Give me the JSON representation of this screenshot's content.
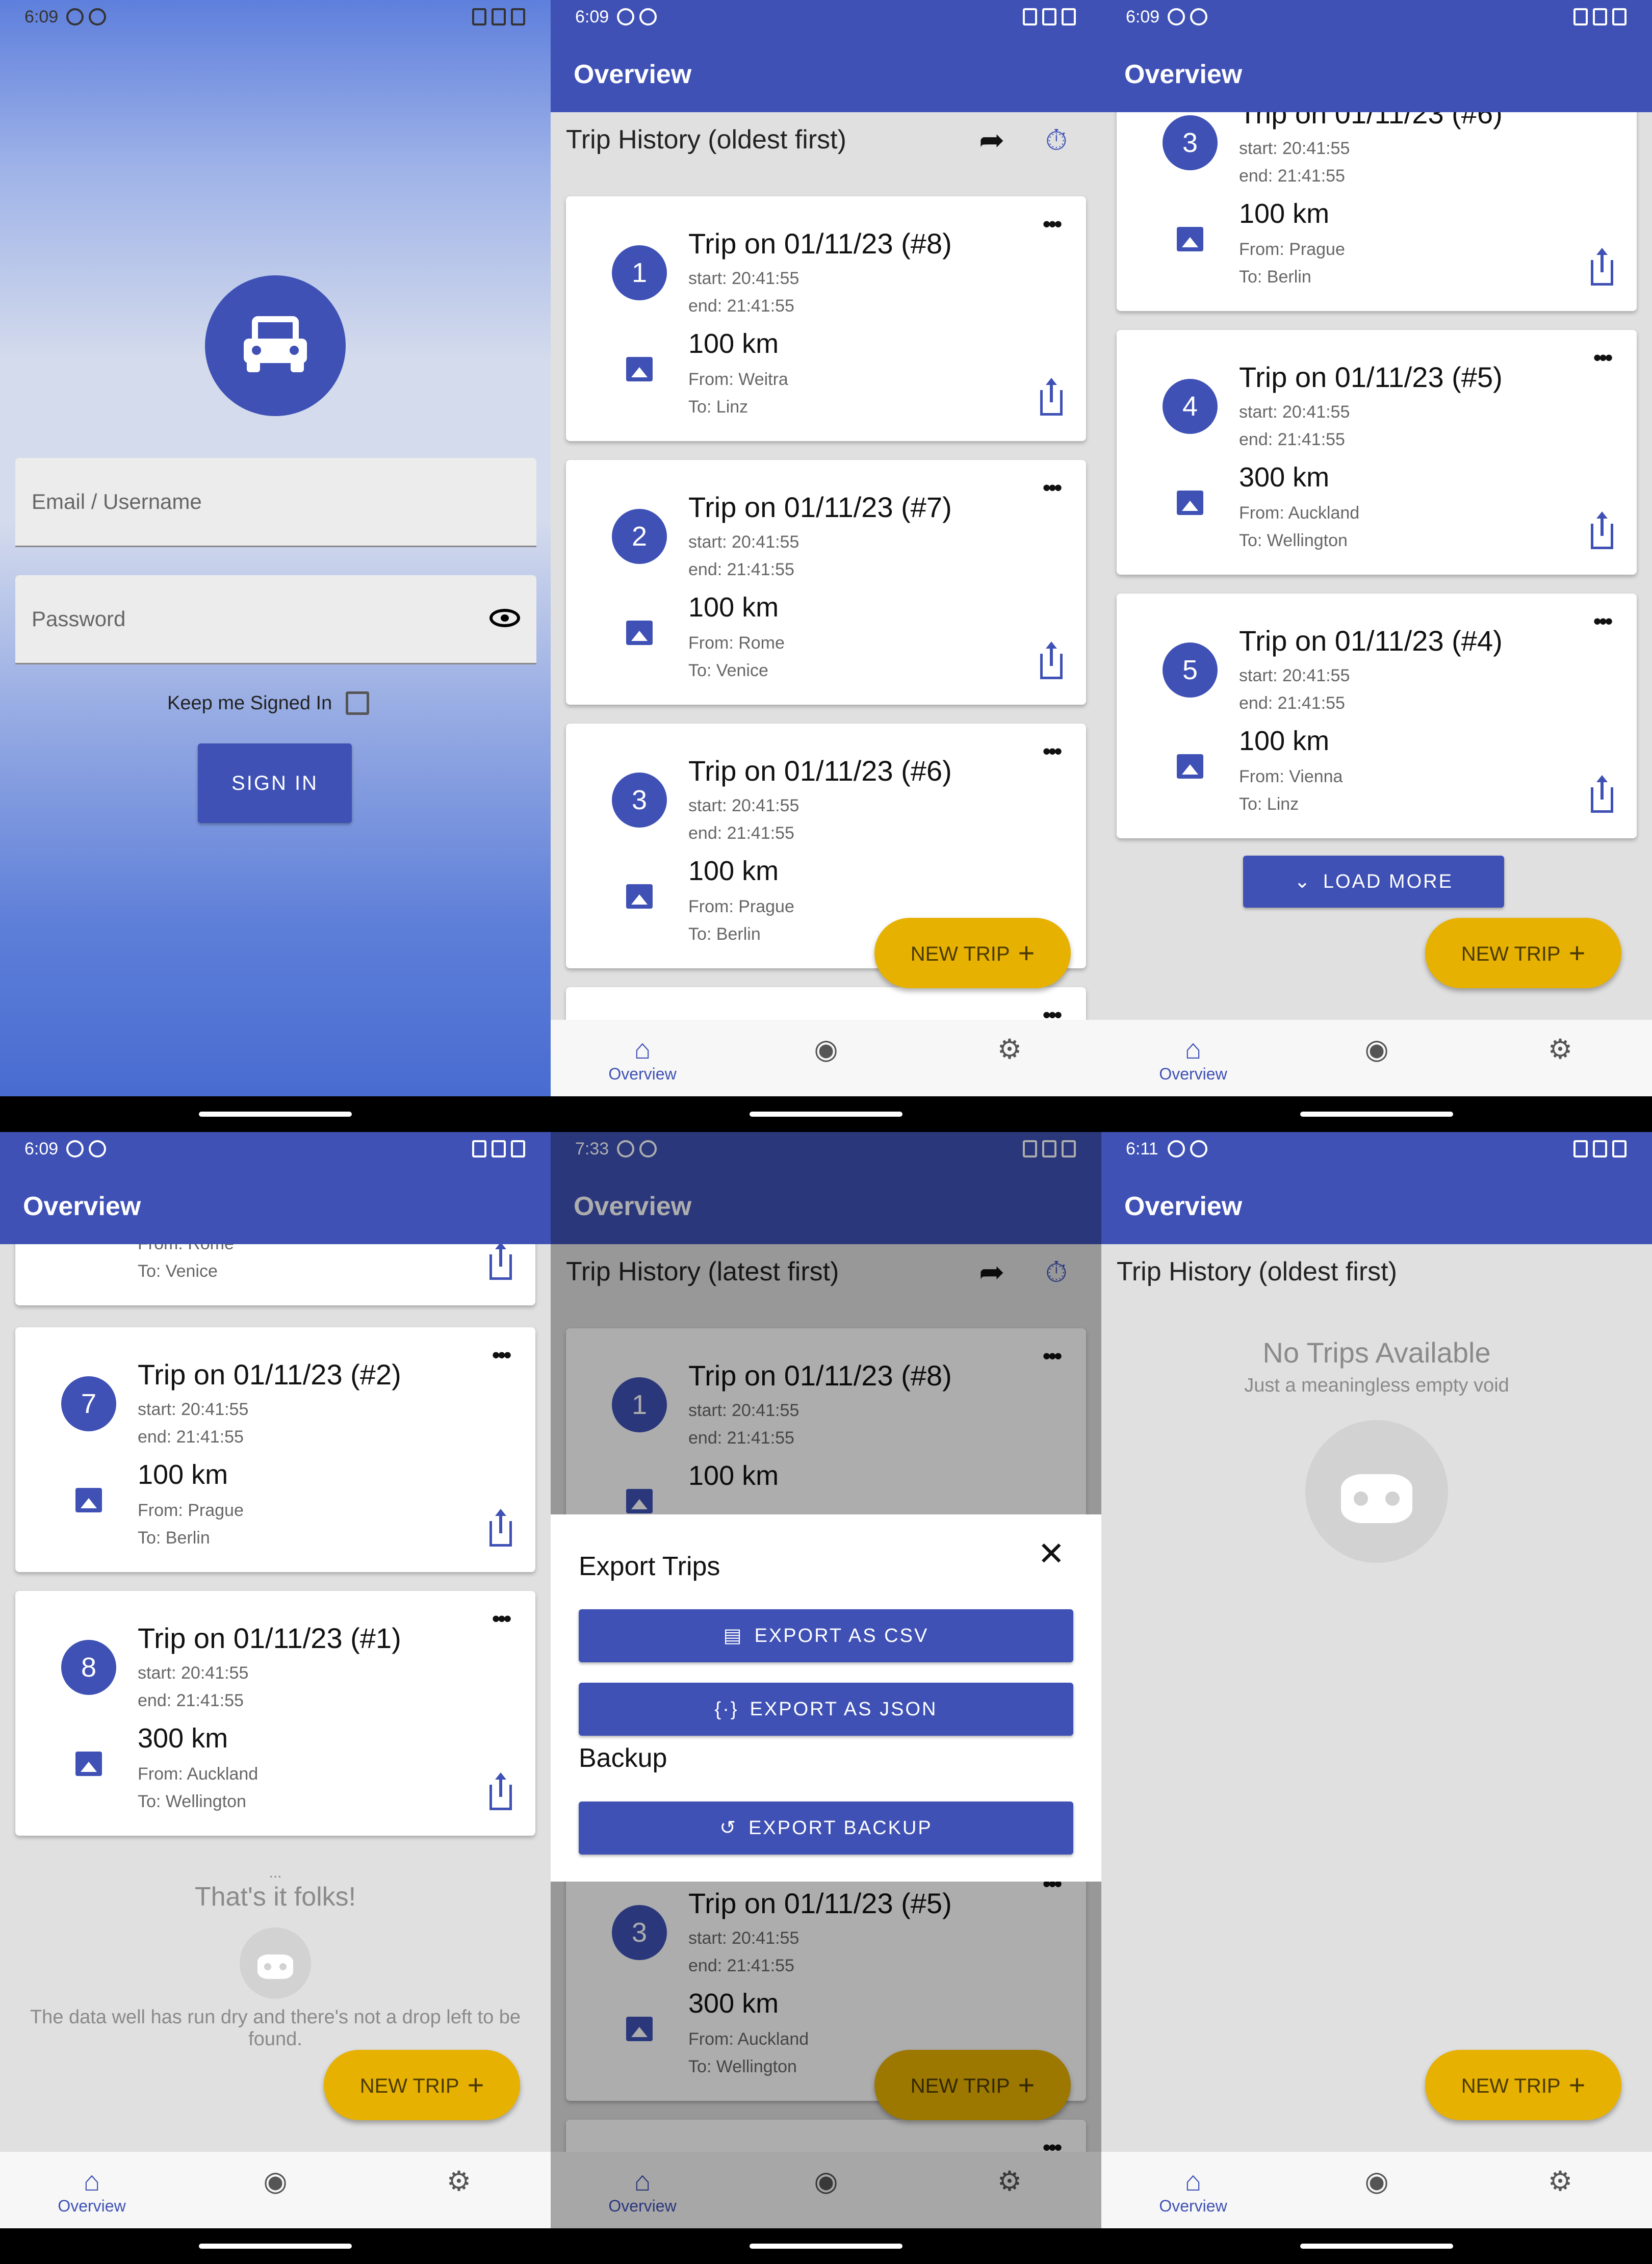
{
  "status": {
    "time1": "6:09",
    "time5": "7:33",
    "time6": "6:11"
  },
  "appbar_title": "Overview",
  "login": {
    "email_placeholder": "Email / Username",
    "password_placeholder": "Password",
    "keep_signed_in": "Keep me Signed In",
    "sign_in": "SIGN IN"
  },
  "history": {
    "title_oldest": "Trip History (oldest first)",
    "title_latest": "Trip History (latest first)"
  },
  "common": {
    "start": "start: 20:41:55",
    "end": "end: 21:41:55"
  },
  "trips": [
    {
      "num": "1",
      "title": "Trip on 01/11/23 (#8)",
      "km": "100 km",
      "from": "From: Weitra",
      "to": "To: Linz"
    },
    {
      "num": "2",
      "title": "Trip on 01/11/23 (#7)",
      "km": "100 km",
      "from": "From: Rome",
      "to": "To: Venice"
    },
    {
      "num": "3",
      "title": "Trip on 01/11/23 (#6)",
      "km": "100 km",
      "from": "From: Prague",
      "to": "To: Berlin"
    },
    {
      "num": "4",
      "title": "Trip on 01/11/23 (#5)",
      "km": "300 km",
      "from": "From: Auckland",
      "to": "To: Wellington"
    },
    {
      "num": "5",
      "title": "Trip on 01/11/23 (#4)",
      "km": "100 km",
      "from": "From: Vienna",
      "to": "To: Linz"
    },
    {
      "num": "7",
      "title": "Trip on 01/11/23 (#2)",
      "km": "100 km",
      "from": "From: Prague",
      "to": "To: Berlin"
    },
    {
      "num": "8",
      "title": "Trip on 01/11/23 (#1)",
      "km": "300 km",
      "from": "From: Auckland",
      "to": "To: Wellington"
    },
    {
      "num": "3",
      "title": "Trip on 01/11/23 (#5)",
      "km": "300 km",
      "from": "From: Auckland",
      "to": "To: Wellington"
    }
  ],
  "partial": {
    "from": "From: Rome",
    "to": "To: Venice"
  },
  "load_more": "LOAD MORE",
  "new_trip": "NEW TRIP",
  "nav": {
    "overview": "Overview"
  },
  "end_of_list": {
    "dots": "...",
    "title": "That's it folks!",
    "message": "The data well has run dry and there's not a drop left to be found."
  },
  "export_sheet": {
    "title": "Export Trips",
    "csv": "EXPORT AS CSV",
    "json": "EXPORT AS JSON",
    "backup_title": "Backup",
    "backup": "EXPORT BACKUP"
  },
  "empty": {
    "title": "No Trips Available",
    "subtitle": "Just a meaningless empty void"
  },
  "icons": [
    "car-icon",
    "eye-icon",
    "share-icon",
    "sort-icon",
    "more-icon",
    "image-icon",
    "home-icon",
    "account-icon",
    "settings-icon",
    "close-icon",
    "csv-file-icon",
    "json-icon",
    "backup-icon",
    "chevron-down-icon",
    "plus-icon",
    "robot-icon"
  ],
  "colors": {
    "primary": "#3f51b5",
    "fab": "#e6b100",
    "background": "#e0e0e0"
  }
}
